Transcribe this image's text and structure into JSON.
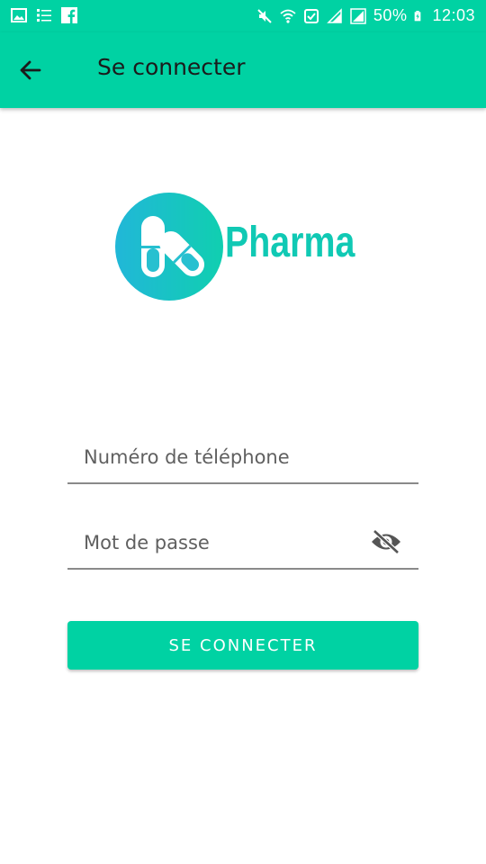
{
  "status_bar": {
    "battery": "50%",
    "time": "12:03",
    "icons": [
      "gallery-icon",
      "list-icon",
      "facebook-icon",
      "mute-icon",
      "wifi-icon",
      "notification-icon",
      "signal-icon",
      "signal-icon",
      "battery-charging-icon"
    ]
  },
  "app_bar": {
    "back_icon": "arrow-back-icon",
    "title": "Se connecter"
  },
  "logo": {
    "text": "Pharma"
  },
  "form": {
    "phone_placeholder": "Numéro de téléphone",
    "password_placeholder": "Mot de passe",
    "visibility_icon": "eye-off-icon",
    "submit_label": "SE CONNECTER"
  },
  "colors": {
    "primary": "#00d2a3",
    "logo_teal": "#10c9b4",
    "logo_blue": "#21b7d8",
    "underline": "#8a8a8a"
  }
}
